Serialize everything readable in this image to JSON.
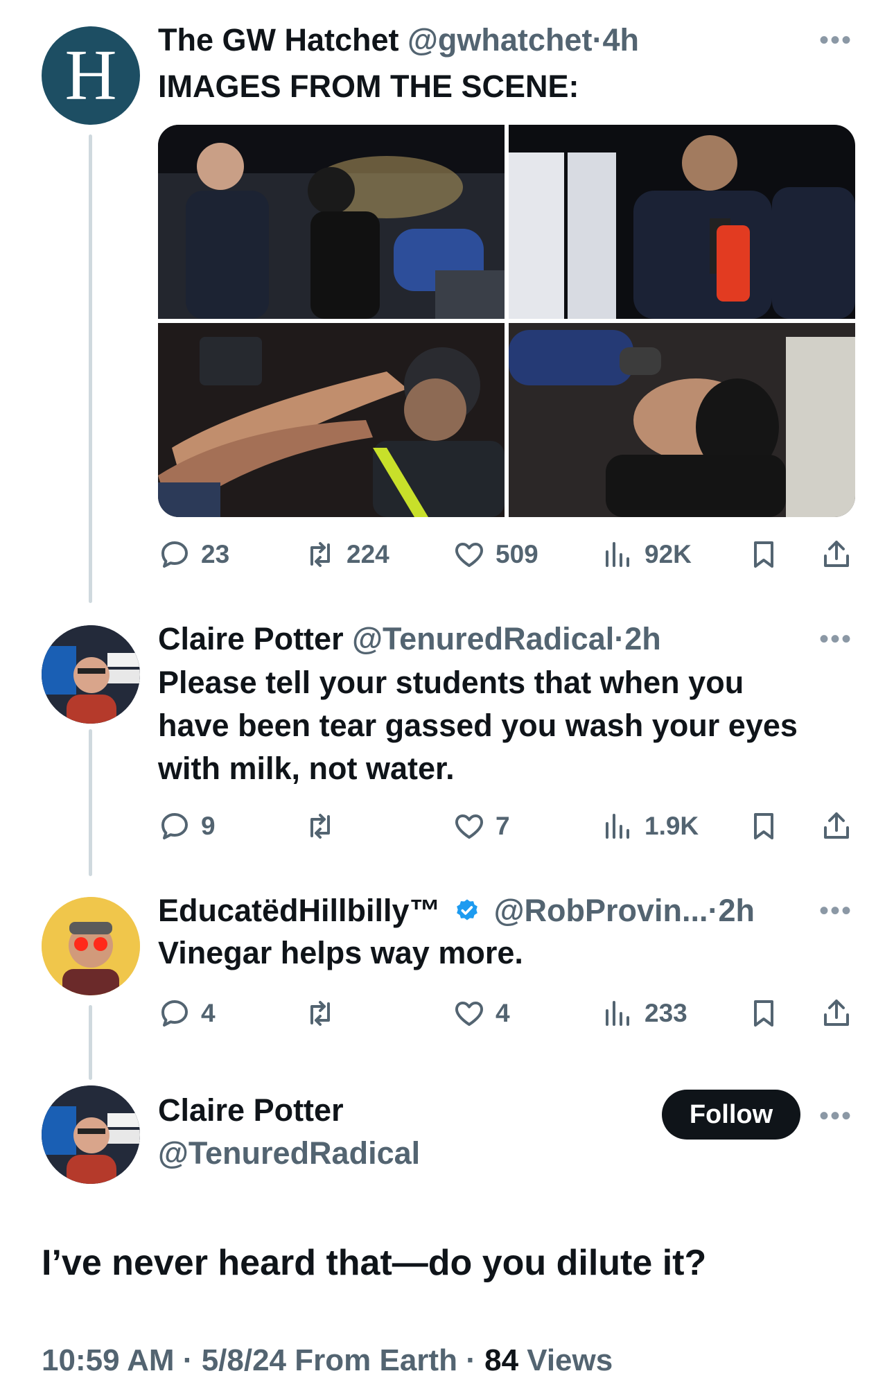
{
  "tweets": [
    {
      "name": "The GW Hatchet",
      "handle": "@gwhatchet",
      "time": "4h",
      "text": "IMAGES FROM THE SCENE:",
      "avatar_letter": "H",
      "replies": "23",
      "retweets": "224",
      "likes": "509",
      "views": "92K"
    },
    {
      "name": "Claire Potter",
      "handle": "@TenuredRadical",
      "time": "2h",
      "text_lines": [
        "Please tell your students that when you",
        "have been tear gassed you wash your eyes",
        "with milk, not water."
      ],
      "replies": "9",
      "retweets": "",
      "likes": "7",
      "views": "1.9K"
    },
    {
      "name": "EducatëdHillbilly™",
      "handle": "@RobProvin...",
      "time": "2h",
      "text": "Vinegar helps way more.",
      "replies": "4",
      "retweets": "",
      "likes": "4",
      "views": "233"
    }
  ],
  "main_post": {
    "name": "Claire Potter",
    "handle": "@TenuredRadical",
    "follow_label": "Follow",
    "text": "I’ve never heard that—do you dilute it?",
    "time": "10:59 AM",
    "date": "5/8/24",
    "source": "From Earth",
    "views_count": "84",
    "views_label": "Views"
  },
  "separator": "·",
  "more_glyph": "•••",
  "colors": {
    "hatchet_avatar": "#1d4e63",
    "verified": "#1d9bf0",
    "follow_bg": "#0f1419",
    "secondary_text": "#536471"
  }
}
